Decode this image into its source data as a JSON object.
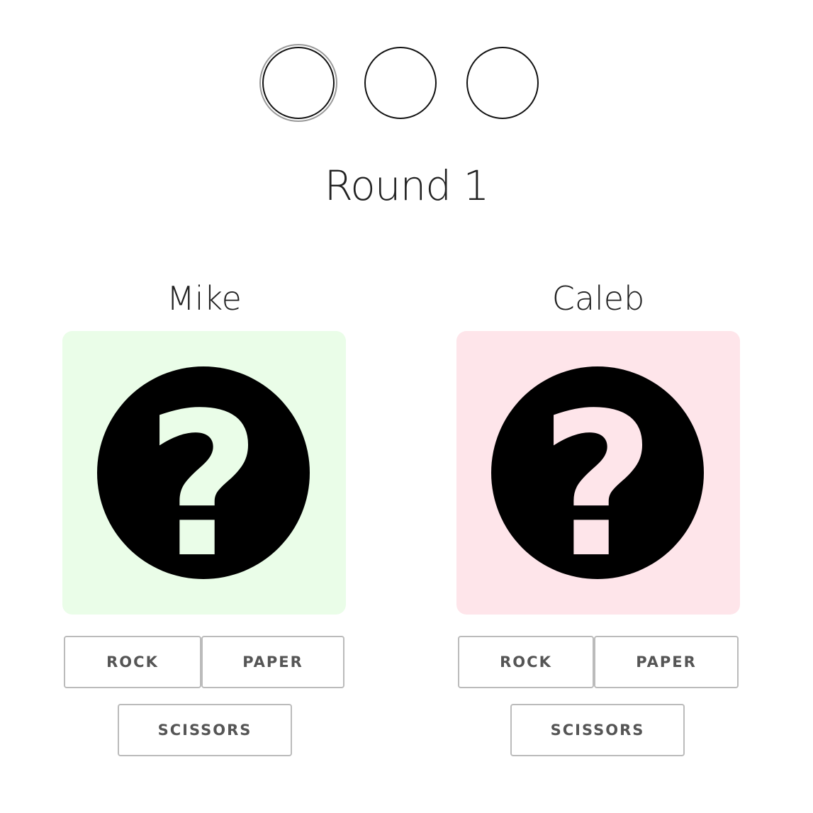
{
  "round": {
    "title": "Round 1",
    "dots": [
      {
        "state": "current"
      },
      {
        "state": "pending"
      },
      {
        "state": "pending"
      }
    ]
  },
  "players": [
    {
      "name": "Mike",
      "card_color": "#eafde8",
      "icon": "question-mark-icon",
      "buttons": {
        "rock": "ROCK",
        "paper": "PAPER",
        "scissors": "SCISSORS"
      }
    },
    {
      "name": "Caleb",
      "card_color": "#fee5ea",
      "icon": "question-mark-icon",
      "buttons": {
        "rock": "ROCK",
        "paper": "PAPER",
        "scissors": "SCISSORS"
      }
    }
  ],
  "colors": {
    "text": "#222222",
    "button_border": "#bbbbbb",
    "button_text": "#555555",
    "icon_circle": "#000000"
  }
}
